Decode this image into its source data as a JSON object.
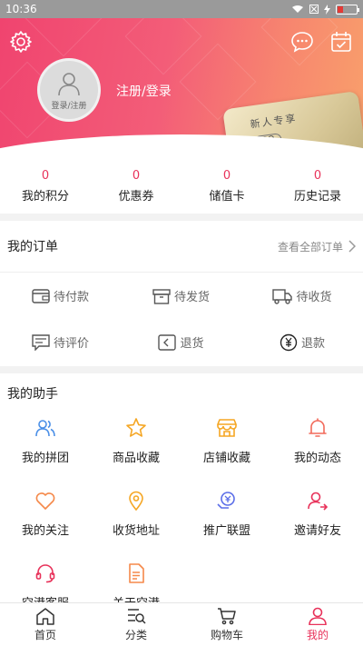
{
  "status_bar": {
    "time": "10:36"
  },
  "header": {
    "avatar_caption": "登录/注册",
    "login_link": "注册/登录",
    "banner": {
      "caption": "新人专享",
      "go": "GO"
    }
  },
  "stats": [
    {
      "value": "0",
      "label": "我的积分"
    },
    {
      "value": "0",
      "label": "优惠券"
    },
    {
      "value": "0",
      "label": "储值卡"
    },
    {
      "value": "0",
      "label": "历史记录"
    }
  ],
  "orders": {
    "title": "我的订单",
    "view_all": "查看全部订单",
    "items": [
      {
        "label": "待付款",
        "icon": "wallet-icon"
      },
      {
        "label": "待发货",
        "icon": "box-icon"
      },
      {
        "label": "待收货",
        "icon": "truck-icon"
      },
      {
        "label": "待评价",
        "icon": "comment-icon"
      },
      {
        "label": "退货",
        "icon": "return-icon"
      },
      {
        "label": "退款",
        "icon": "refund-icon"
      }
    ]
  },
  "assistant": {
    "title": "我的助手",
    "items": [
      {
        "label": "我的拼团",
        "icon": "group-icon",
        "color": "#4a8fe7"
      },
      {
        "label": "商品收藏",
        "icon": "star-icon",
        "color": "#f5a623"
      },
      {
        "label": "店铺收藏",
        "icon": "shop-icon",
        "color": "#f5a623"
      },
      {
        "label": "我的动态",
        "icon": "bell-icon",
        "color": "#f26a5a"
      },
      {
        "label": "我的关注",
        "icon": "heart-icon",
        "color": "#f5894a"
      },
      {
        "label": "收货地址",
        "icon": "location-icon",
        "color": "#f5a623"
      },
      {
        "label": "推广联盟",
        "icon": "promote-icon",
        "color": "#5b6ee8"
      },
      {
        "label": "邀请好友",
        "icon": "invite-icon",
        "color": "#e8325a"
      },
      {
        "label": "空港客服",
        "icon": "headset-icon",
        "color": "#e8325a"
      },
      {
        "label": "关于空港",
        "icon": "document-icon",
        "color": "#f5894a"
      }
    ]
  },
  "tabbar": [
    {
      "label": "首页",
      "icon": "home-icon"
    },
    {
      "label": "分类",
      "icon": "category-icon"
    },
    {
      "label": "购物车",
      "icon": "cart-icon"
    },
    {
      "label": "我的",
      "icon": "user-icon",
      "active": true
    }
  ],
  "colors": {
    "accent": "#e8325a",
    "header_from": "#f0446f",
    "header_to": "#f9a06b"
  }
}
